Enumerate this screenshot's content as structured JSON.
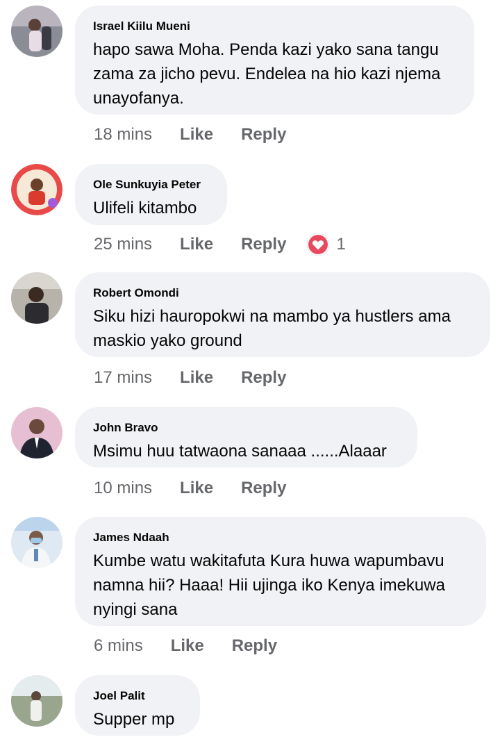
{
  "comments": [
    {
      "name": "Israel Kiilu Mueni",
      "text": "hapo sawa Moha. Penda kazi yako sana tangu zama za jicho pevu. Endelea na hio kazi njema unayofanya.",
      "time": "18 mins",
      "like": "Like",
      "reply": "Reply"
    },
    {
      "name": "Ole Sunkuyia Peter",
      "text": "Ulifeli kitambo",
      "time": "25 mins",
      "like": "Like",
      "reply": "Reply",
      "reaction_count": "1"
    },
    {
      "name": "Robert Omondi",
      "text": "Siku hizi hauropokwi na mambo ya hustlers ama maskio yako ground",
      "time": "17 mins",
      "like": "Like",
      "reply": "Reply"
    },
    {
      "name": "John Bravo",
      "text": "Msimu huu tatwaona sanaaa ......Alaaar",
      "time": "10 mins",
      "like": "Like",
      "reply": "Reply"
    },
    {
      "name": "James Ndaah",
      "text": "Kumbe watu wakitafuta Kura huwa wapumbavu namna hii? Haaa! Hii ujinga iko Kenya imekuwa nyingi sana",
      "time": "6 mins",
      "like": "Like",
      "reply": "Reply"
    },
    {
      "name": "Joel Palit",
      "text": "Supper mp"
    }
  ],
  "colors": {
    "bubble": "#f0f2f5",
    "meta_text": "#65676b",
    "love_reaction": "#e8495e"
  },
  "icons": {
    "reaction": "love-heart-icon"
  }
}
